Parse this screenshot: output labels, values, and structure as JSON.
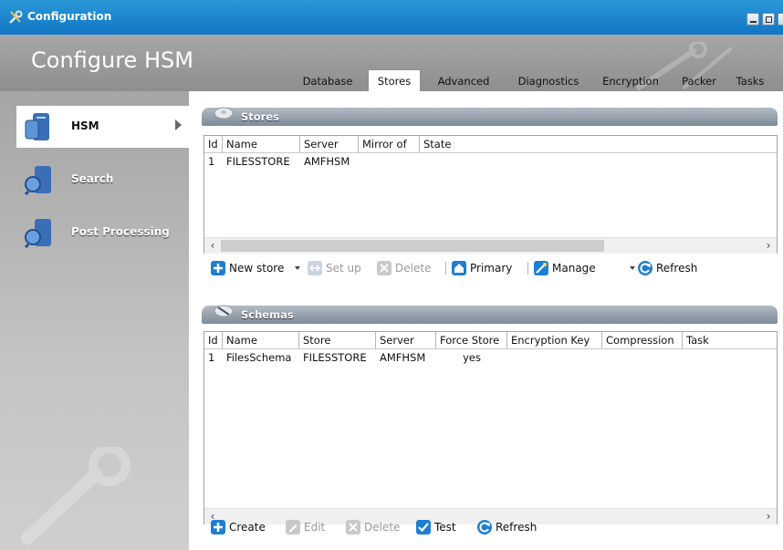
{
  "window": {
    "title": "Configuration"
  },
  "header": {
    "app_title": "Configure HSM"
  },
  "tabs": [
    {
      "label": "Database"
    },
    {
      "label": "Stores",
      "active": true
    },
    {
      "label": "Advanced"
    },
    {
      "label": "Diagnostics"
    },
    {
      "label": "Encryption"
    },
    {
      "label": "Packer"
    },
    {
      "label": "Tasks"
    }
  ],
  "sidebar": {
    "items": [
      {
        "label": "HSM",
        "active": true
      },
      {
        "label": "Search"
      },
      {
        "label": "Post Processing"
      }
    ]
  },
  "stores": {
    "title": "Stores",
    "columns": [
      "Id",
      "Name",
      "Server",
      "Mirror of",
      "State"
    ],
    "rows": [
      {
        "id": "1",
        "name": "FILESSTORE",
        "server": "AMFHSM",
        "mirror_of": "",
        "state": ""
      }
    ],
    "toolbar": {
      "new_store": "New store",
      "set_up": "Set up",
      "delete": "Delete",
      "primary": "Primary",
      "manage": "Manage",
      "refresh": "Refresh"
    }
  },
  "schemas": {
    "title": "Schemas",
    "columns": [
      "Id",
      "Name",
      "Store",
      "Server",
      "Force Store",
      "Encryption Key",
      "Compression",
      "Task"
    ],
    "rows": [
      {
        "id": "1",
        "name": "FilesSchema",
        "store": "FILESSTORE",
        "server": "AMFHSM",
        "force_store": "yes",
        "encryption_key": "",
        "compression": "",
        "task": ""
      }
    ],
    "toolbar": {
      "create": "Create",
      "edit": "Edit",
      "delete": "Delete",
      "test": "Test",
      "refresh": "Refresh"
    }
  },
  "colors": {
    "titlebar": "#1a85d0",
    "header": "#9a9a9a",
    "section_bar": "#8f9ba8",
    "accent_blue": "#1e7fd0"
  }
}
